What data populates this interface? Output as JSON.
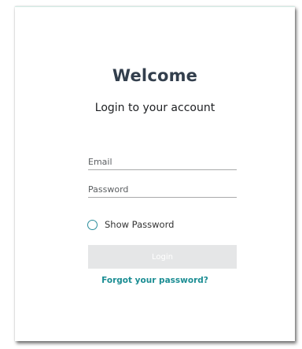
{
  "login": {
    "title": "Welcome",
    "subtitle": "Login to your account",
    "email_placeholder": "Email",
    "email_value": "",
    "password_placeholder": "Password",
    "password_value": "",
    "show_password_label": "Show Password",
    "login_label": "Login",
    "forgot_label": "Forgot your password?"
  },
  "icons": {
    "show_password_toggle": "radio-circle-icon"
  },
  "colors": {
    "title": "#333f4d",
    "accent": "#1b8d93",
    "radio_border": "#2b8e9c",
    "button_disabled_bg": "#e5e6e7"
  }
}
